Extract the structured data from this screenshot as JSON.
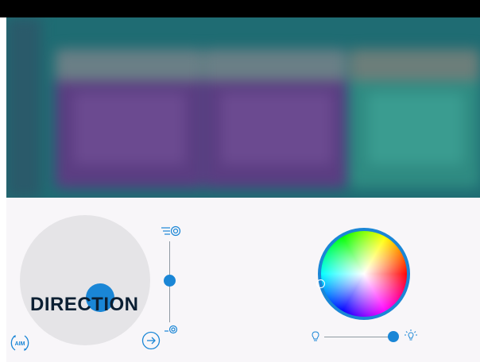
{
  "controls": {
    "direction_label": "DIRECTION",
    "aim_label": "AIM",
    "speed_level": 0.5,
    "brightness_level": 0.9
  },
  "colors": {
    "accent": "#1a86d6",
    "panel_bg": "#f8f6f9",
    "joystick_bg": "#e5e4e7",
    "label_text": "#0b1f33"
  },
  "icons": {
    "speed_fast": "speed-fast-icon",
    "speed_slow": "speed-slow-icon",
    "aim": "aim-icon",
    "direction_arrow": "arrow-right-circle-icon",
    "bulb_dim": "bulb-dim-icon",
    "bulb_bright": "bulb-bright-icon"
  }
}
